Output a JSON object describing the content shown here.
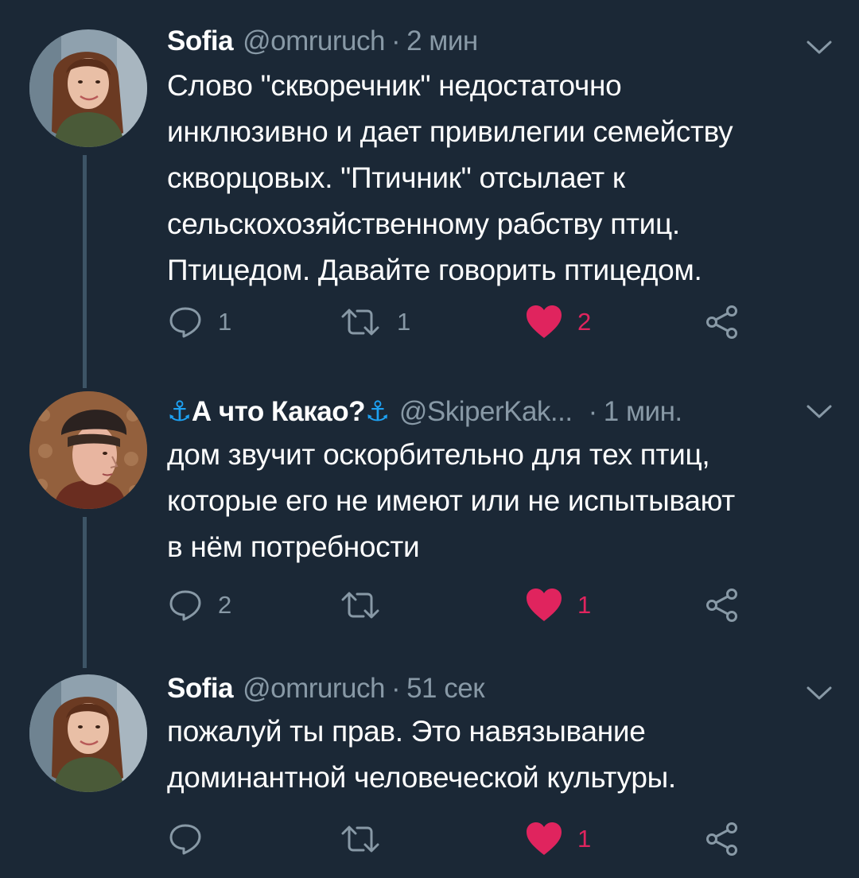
{
  "colors": {
    "background": "#1b2836",
    "text": "#ffffff",
    "secondary": "#8899a6",
    "like": "#e0245e",
    "anchor": "#1da1f2",
    "thread_line": "#3d5466"
  },
  "tweets": [
    {
      "name": "Sofia",
      "handle": "@omruruch",
      "separator": "·",
      "time": "2 мин",
      "lines": [
        "Слово \"скворечник\" недостаточно",
        "инклюзивно и дает привилегии семейству",
        "скворцовых. \"Птичник\" отсылает к",
        "сельскохозяйственному рабству птиц.",
        "Птицедом. Давайте говорить птицедом."
      ],
      "replies": "1",
      "retweets": "1",
      "likes": "2",
      "liked": true
    },
    {
      "name_prefix": "⚓",
      "name": "А что Какао?",
      "name_suffix": "⚓",
      "handle": "@SkiperKak...",
      "separator": "·",
      "time": "1 мин.",
      "lines": [
        "дом звучит оскорбительно для тех птиц,",
        "которые его не имеют или не испытывают",
        "в нём потребности"
      ],
      "replies": "2",
      "retweets": "",
      "likes": "1",
      "liked": true
    },
    {
      "name": "Sofia",
      "handle": "@omruruch",
      "separator": "·",
      "time": "51 сек",
      "lines": [
        "пожалуй ты прав. Это навязывание",
        "доминантной человеческой культуры."
      ],
      "replies": "",
      "retweets": "",
      "likes": "1",
      "liked": true
    }
  ]
}
